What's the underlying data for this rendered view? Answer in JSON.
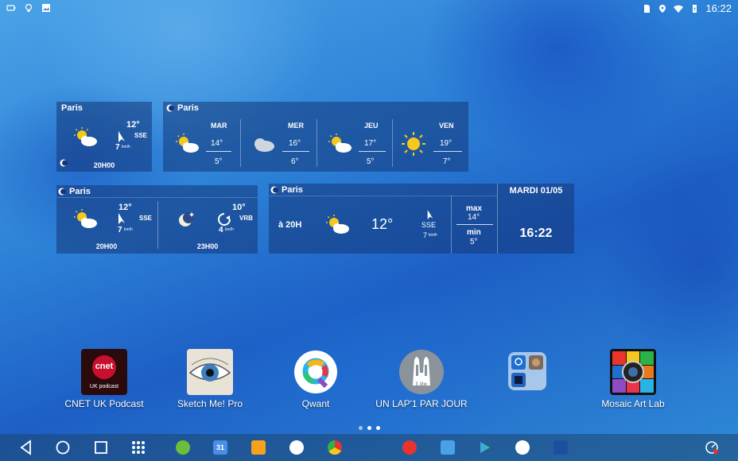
{
  "status_bar": {
    "time": "16:22",
    "left_icons": [
      "battery-icon",
      "lightbulb-icon",
      "image-icon"
    ],
    "right_icons": [
      "sim-icon",
      "location-icon",
      "wifi-icon",
      "battery-charging-icon"
    ]
  },
  "widget_small": {
    "city": "Paris",
    "temp": "12°",
    "wind_dir": "SSE",
    "wind_speed": "7",
    "wind_unit": "km/h",
    "time": "20H00"
  },
  "widget_forecast": {
    "city": "Paris",
    "days": [
      {
        "name": "MAR",
        "high": "14°",
        "low": "5°",
        "icon": "partly-cloudy-icon"
      },
      {
        "name": "MER",
        "high": "16°",
        "low": "6°",
        "icon": "cloud-icon"
      },
      {
        "name": "JEU",
        "high": "17°",
        "low": "5°",
        "icon": "partly-cloudy-icon"
      },
      {
        "name": "VEN",
        "high": "19°",
        "low": "7°",
        "icon": "sun-icon"
      }
    ]
  },
  "widget_double": {
    "city": "Paris",
    "left": {
      "temp": "12°",
      "wind_dir": "SSE",
      "wind_speed": "7",
      "wind_unit": "km/h",
      "time": "20H00"
    },
    "right": {
      "temp": "10°",
      "wind_dir": "VRB",
      "wind_speed": "4",
      "wind_unit": "km/h",
      "time": "23H00"
    }
  },
  "widget_large": {
    "city": "Paris",
    "at_time": "à 20H",
    "temp": "12°",
    "wind_dir": "SSE",
    "wind_speed": "7",
    "wind_unit": "km/h",
    "max_label": "max",
    "max_value": "14°",
    "min_label": "min",
    "min_value": "5°",
    "date": "MARDI 01/05",
    "clock": "16:22"
  },
  "apps": [
    {
      "label": "CNET UK Podcast",
      "icon_text": "cnet",
      "icon_sub": "UK podcast"
    },
    {
      "label": "Sketch Me! Pro"
    },
    {
      "label": "Qwant"
    },
    {
      "label": "UN LAP'1 PAR JOUR",
      "icon_text": "Lite"
    },
    {
      "label": ""
    },
    {
      "label": "Mosaic Art Lab"
    }
  ],
  "dock": {
    "calendar_day": "31",
    "icons": [
      "settings-icon",
      "calendar-icon",
      "notes-icon",
      "voice-search-icon",
      "chrome-icon",
      "app-store-icon",
      "game-icon",
      "play-store-icon",
      "maps-icon",
      "weather-icon"
    ]
  },
  "colors": {
    "panel": "#14377a",
    "qwant_q": "#e8e8e8",
    "cnet_red": "#c8102e"
  }
}
